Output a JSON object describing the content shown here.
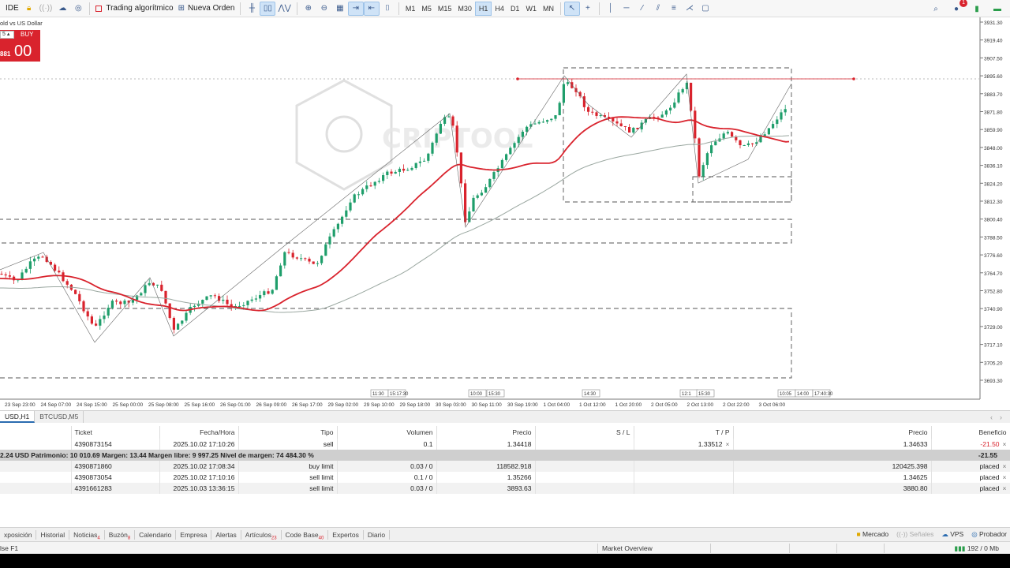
{
  "toolbar": {
    "ide_label": "IDE",
    "algo_label": "Trading algorítmico",
    "new_order_label": "Nueva Orden",
    "timeframes": [
      "M1",
      "M5",
      "M15",
      "M30",
      "H1",
      "H4",
      "D1",
      "W1",
      "MN"
    ],
    "active_timeframe": "H1",
    "notification_count": "1"
  },
  "chart": {
    "symbol": "old vs US Dollar",
    "buy_label": "BUY",
    "buy_price_small": "881",
    "buy_price_big": "00",
    "spinner_value": "5",
    "watermark": "CRIPTOOL",
    "price_labels": [
      "3931.30",
      "3919.40",
      "3907.50",
      "3895.60",
      "3883.70",
      "3871.80",
      "3859.90",
      "3848.00",
      "3836.10",
      "3824.20",
      "3812.30",
      "3800.40",
      "3788.50",
      "3776.60",
      "3764.70",
      "3752.80",
      "3740.90",
      "3729.00",
      "3717.10",
      "3705.20",
      "3693.30"
    ],
    "time_labels": [
      "23 Sep 23:00",
      "24 Sep 07:00",
      "24 Sep 15:00",
      "25 Sep 00:00",
      "25 Sep 08:00",
      "25 Sep 16:00",
      "26 Sep 01:00",
      "26 Sep 09:00",
      "26 Sep 17:00",
      "29 Sep 02:00",
      "29 Sep 10:00",
      "29 Sep 18:00",
      "30 Sep 03:00",
      "30 Sep 11:00",
      "30 Sep 19:00",
      "1 Oct 04:00",
      "1 Oct 12:00",
      "1 Oct 20:00",
      "2 Oct 05:00",
      "2 Oct 13:00",
      "2 Oct 22:00",
      "3 Oct 06:00"
    ],
    "time_markers": [
      "11:30",
      "15:17:30",
      "10:00",
      "15:30",
      "14:30",
      "12:1",
      "15:30",
      "10:05",
      "14:00",
      "17:40:30"
    ],
    "colors": {
      "bull": "#1f9e6b",
      "bear": "#d9232d",
      "ma_fast": "#d9232d",
      "ma_slow": "#9aa7a0",
      "grid_dash": "#555555"
    }
  },
  "chart_tabs": {
    "tab1": "USD,H1",
    "tab2": "BTCUSD,M5"
  },
  "trades": {
    "headers": [
      "Ticket",
      "Fecha/Hora",
      "Tipo",
      "Volumen",
      "Precio",
      "S / L",
      "T / P",
      "Precio",
      "Beneficio"
    ],
    "position": {
      "ticket": "4390873154",
      "time": "2025.10.02 17:10:26",
      "type": "sell",
      "volume": "0.1",
      "price": "1.34418",
      "sl": "",
      "tp": "1.33512",
      "current": "1.34633",
      "profit": "-21.50"
    },
    "balance_line": "2.24 USD  Patrimonio: 10 010.69  Margen: 13.44  Margen libre: 9 997.25  Nivel de margen: 74 484.30 %",
    "balance_profit": "-21.55",
    "orders": [
      {
        "ticket": "4390871860",
        "time": "2025.10.02 17:08:34",
        "type": "buy limit",
        "volume": "0.03 / 0",
        "price": "118582.918",
        "sl": "",
        "tp": "",
        "current": "120425.398",
        "status": "placed"
      },
      {
        "ticket": "4390873054",
        "time": "2025.10.02 17:10:16",
        "type": "sell limit",
        "volume": "0.1 / 0",
        "price": "1.35266",
        "sl": "",
        "tp": "",
        "current": "1.34625",
        "status": "placed"
      },
      {
        "ticket": "4391661283",
        "time": "2025.10.03 13:36:15",
        "type": "sell limit",
        "volume": "0.03 / 0",
        "price": "3893.63",
        "sl": "",
        "tp": "",
        "current": "3880.80",
        "status": "placed"
      }
    ],
    "close_glyph": "×"
  },
  "bottom_tabs": {
    "items": [
      {
        "label": "xposición",
        "badge": ""
      },
      {
        "label": "Historial",
        "badge": ""
      },
      {
        "label": "Noticias",
        "badge": "4"
      },
      {
        "label": "Buzón",
        "badge": "8"
      },
      {
        "label": "Calendario",
        "badge": ""
      },
      {
        "label": "Empresa",
        "badge": ""
      },
      {
        "label": "Alertas",
        "badge": ""
      },
      {
        "label": "Artículos",
        "badge": "23"
      },
      {
        "label": "Code Base",
        "badge": "40"
      },
      {
        "label": "Expertos",
        "badge": ""
      },
      {
        "label": "Diario",
        "badge": ""
      }
    ],
    "market": "Mercado",
    "signals": "Señales",
    "vps": "VPS",
    "tester": "Probador"
  },
  "status": {
    "left": "lse F1",
    "market_overview": "Market Overview",
    "memory": "192 / 0 Mb"
  }
}
